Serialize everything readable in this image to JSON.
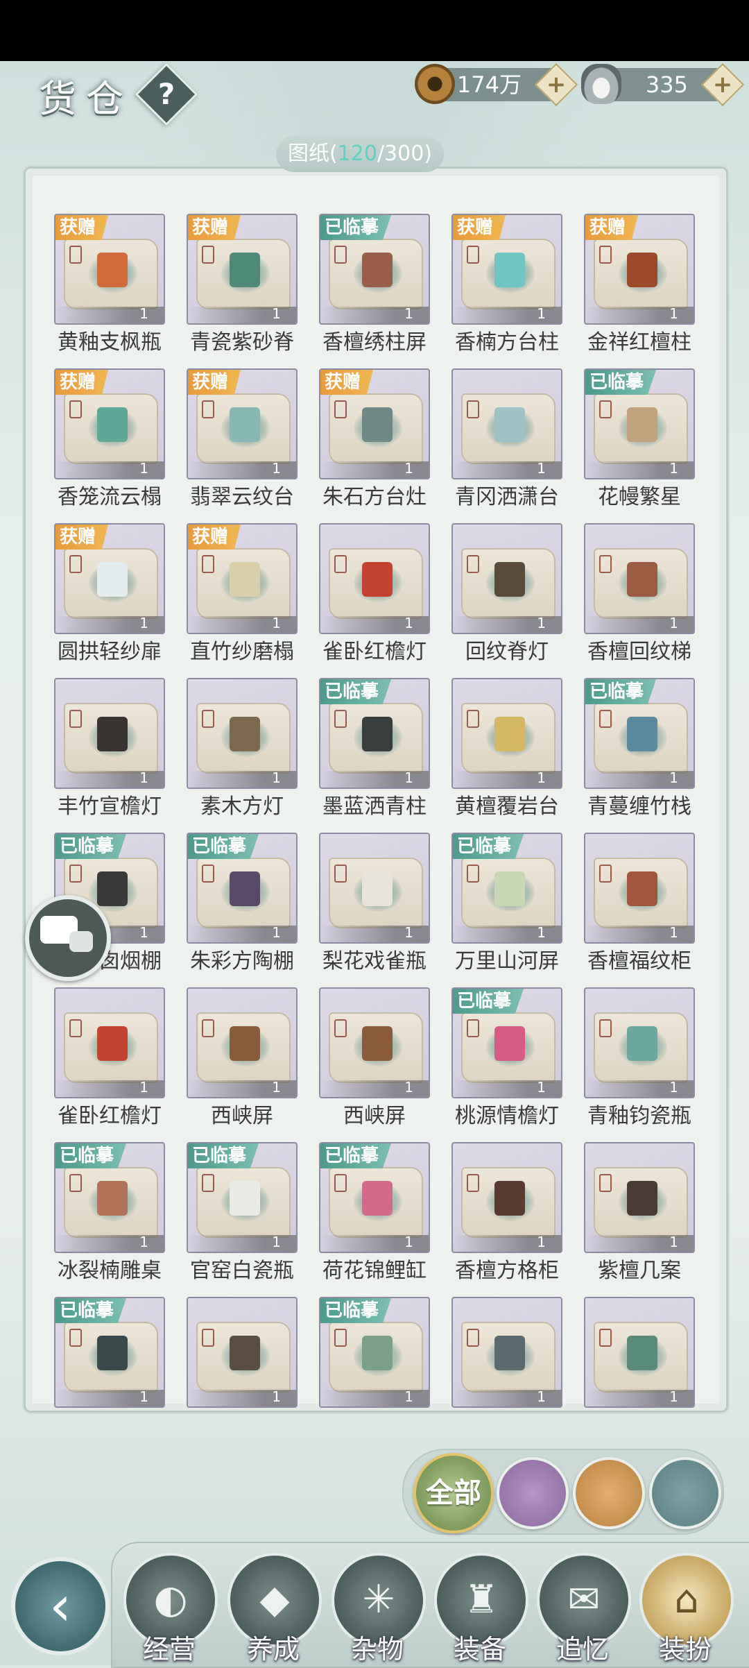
{
  "header": {
    "title": "货仓",
    "help_label": "?",
    "copper_coins": "174万",
    "silver": "335",
    "plus_label": "+"
  },
  "counter": {
    "label": "图纸",
    "open": "(",
    "current": "120",
    "separator": "/",
    "total": "300",
    "close": ")"
  },
  "badges": {
    "gift": "获赠",
    "copied": "已临摹"
  },
  "items": [
    {
      "name": "黄釉支枫瓶",
      "badge": "gift",
      "count": "1",
      "obj_color": "#d26b3a"
    },
    {
      "name": "青瓷紫砂脊",
      "badge": "gift",
      "count": "1",
      "obj_color": "#4f8a78"
    },
    {
      "name": "香檀绣柱屏",
      "badge": "copied",
      "count": "1",
      "obj_color": "#9a5d4a"
    },
    {
      "name": "香楠方台柱",
      "badge": "gift",
      "count": "1",
      "obj_color": "#6fc4c4"
    },
    {
      "name": "金祥红檀柱",
      "badge": "gift",
      "count": "1",
      "obj_color": "#9c4a2a"
    },
    {
      "name": "香笼流云榻",
      "badge": "gift",
      "count": "1",
      "obj_color": "#5fa898"
    },
    {
      "name": "翡翠云纹台",
      "badge": "gift",
      "count": "1",
      "obj_color": "#88b8b3"
    },
    {
      "name": "朱石方台灶",
      "badge": "gift",
      "count": "1",
      "obj_color": "#6f8a86"
    },
    {
      "name": "青冈洒潇台",
      "badge": "",
      "count": "1",
      "obj_color": "#9fc2c4"
    },
    {
      "name": "花幔繁星",
      "badge": "copied",
      "count": "1",
      "obj_color": "#c2a27c"
    },
    {
      "name": "圆拱轻纱扉",
      "badge": "gift",
      "count": "1",
      "obj_color": "#e5ecee"
    },
    {
      "name": "直竹纱磨榻",
      "badge": "gift",
      "count": "1",
      "obj_color": "#d8cfa8"
    },
    {
      "name": "雀卧红檐灯",
      "badge": "",
      "count": "1",
      "obj_color": "#c2442e"
    },
    {
      "name": "回纹脊灯",
      "badge": "",
      "count": "1",
      "obj_color": "#5a4a3a"
    },
    {
      "name": "香檀回纹梯",
      "badge": "",
      "count": "1",
      "obj_color": "#9a5d44"
    },
    {
      "name": "丰竹宣檐灯",
      "badge": "",
      "count": "1",
      "obj_color": "#3a3532"
    },
    {
      "name": "素木方灯",
      "badge": "",
      "count": "1",
      "obj_color": "#7d6a4e"
    },
    {
      "name": "墨蓝洒青柱",
      "badge": "copied",
      "count": "1",
      "obj_color": "#3a3e3e"
    },
    {
      "name": "黄檀覆岩台",
      "badge": "",
      "count": "1",
      "obj_color": "#d6b765"
    },
    {
      "name": "青蔓缠竹栈",
      "badge": "copied",
      "count": "1",
      "obj_color": "#5a8aa0"
    },
    {
      "name": "扇岩囱烟棚",
      "badge": "copied",
      "count": "1",
      "obj_color": "#3a3a3a"
    },
    {
      "name": "朱彩方陶棚",
      "badge": "copied",
      "count": "1",
      "obj_color": "#5a4a6a"
    },
    {
      "name": "梨花戏雀瓶",
      "badge": "",
      "count": "1",
      "obj_color": "#e8e4dc"
    },
    {
      "name": "万里山河屏",
      "badge": "copied",
      "count": "1",
      "obj_color": "#c9d6b4"
    },
    {
      "name": "香檀福纹柜",
      "badge": "",
      "count": "1",
      "obj_color": "#a0563a"
    },
    {
      "name": "雀卧红檐灯",
      "badge": "",
      "count": "1",
      "obj_color": "#c2442e"
    },
    {
      "name": "西峡屏",
      "badge": "",
      "count": "1",
      "obj_color": "#8a5a3a"
    },
    {
      "name": "西峡屏",
      "badge": "",
      "count": "1",
      "obj_color": "#8a5a3a"
    },
    {
      "name": "桃源情檐灯",
      "badge": "copied",
      "count": "1",
      "obj_color": "#d85a86"
    },
    {
      "name": "青釉钧瓷瓶",
      "badge": "",
      "count": "1",
      "obj_color": "#6aa8a0"
    },
    {
      "name": "冰裂楠雕桌",
      "badge": "copied",
      "count": "1",
      "obj_color": "#b0735a"
    },
    {
      "name": "官窑白瓷瓶",
      "badge": "copied",
      "count": "1",
      "obj_color": "#e8ece4"
    },
    {
      "name": "荷花锦鲤缸",
      "badge": "copied",
      "count": "1",
      "obj_color": "#d46a8a"
    },
    {
      "name": "香檀方格柜",
      "badge": "",
      "count": "1",
      "obj_color": "#5a3a2e"
    },
    {
      "name": "紫檀几案",
      "badge": "",
      "count": "1",
      "obj_color": "#4a3a34"
    },
    {
      "name": "",
      "badge": "copied",
      "count": "1",
      "obj_color": "#3a4a4a"
    },
    {
      "name": "",
      "badge": "",
      "count": "1",
      "obj_color": "#5a4e42"
    },
    {
      "name": "",
      "badge": "copied",
      "count": "1",
      "obj_color": "#7aa08a"
    },
    {
      "name": "",
      "badge": "",
      "count": "1",
      "obj_color": "#5a6a6e"
    },
    {
      "name": "",
      "badge": "",
      "count": "1",
      "obj_color": "#5a8a7a"
    }
  ],
  "filters": {
    "all_label": "全部"
  },
  "nav": {
    "back_glyph": "‹",
    "items": [
      {
        "label": "经营",
        "glyph": "◐"
      },
      {
        "label": "养成",
        "glyph": "◆"
      },
      {
        "label": "杂物",
        "glyph": "✳"
      },
      {
        "label": "装备",
        "glyph": "♜"
      },
      {
        "label": "追忆",
        "glyph": "✉"
      },
      {
        "label": "装扮",
        "glyph": "⌂"
      }
    ]
  }
}
